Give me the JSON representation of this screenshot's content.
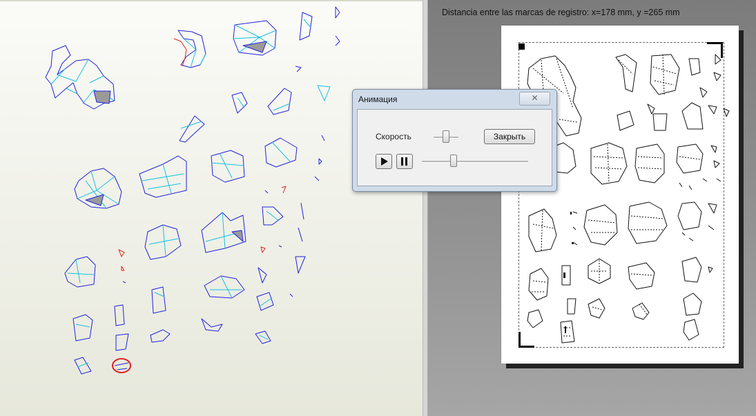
{
  "ruler_info": "Distancia entre las marcas de registro: x=178 mm, y =265 mm",
  "dialog": {
    "title": "Анимация",
    "speed_label": "Скорость",
    "close_button": "Закрыть",
    "close_icon": "x-icon",
    "play_icon": "play-icon",
    "pause_icon": "pause-icon",
    "speed_level": 0.5,
    "position_level": 0.3
  },
  "colors": {
    "fold_line": "#2222dd",
    "accent_line": "#18c0e0",
    "cut_line": "#e02020",
    "canvas_top": "#fbfbf8",
    "canvas_bottom": "#e7e8dc",
    "preview_bg": "#8a8a8a"
  }
}
